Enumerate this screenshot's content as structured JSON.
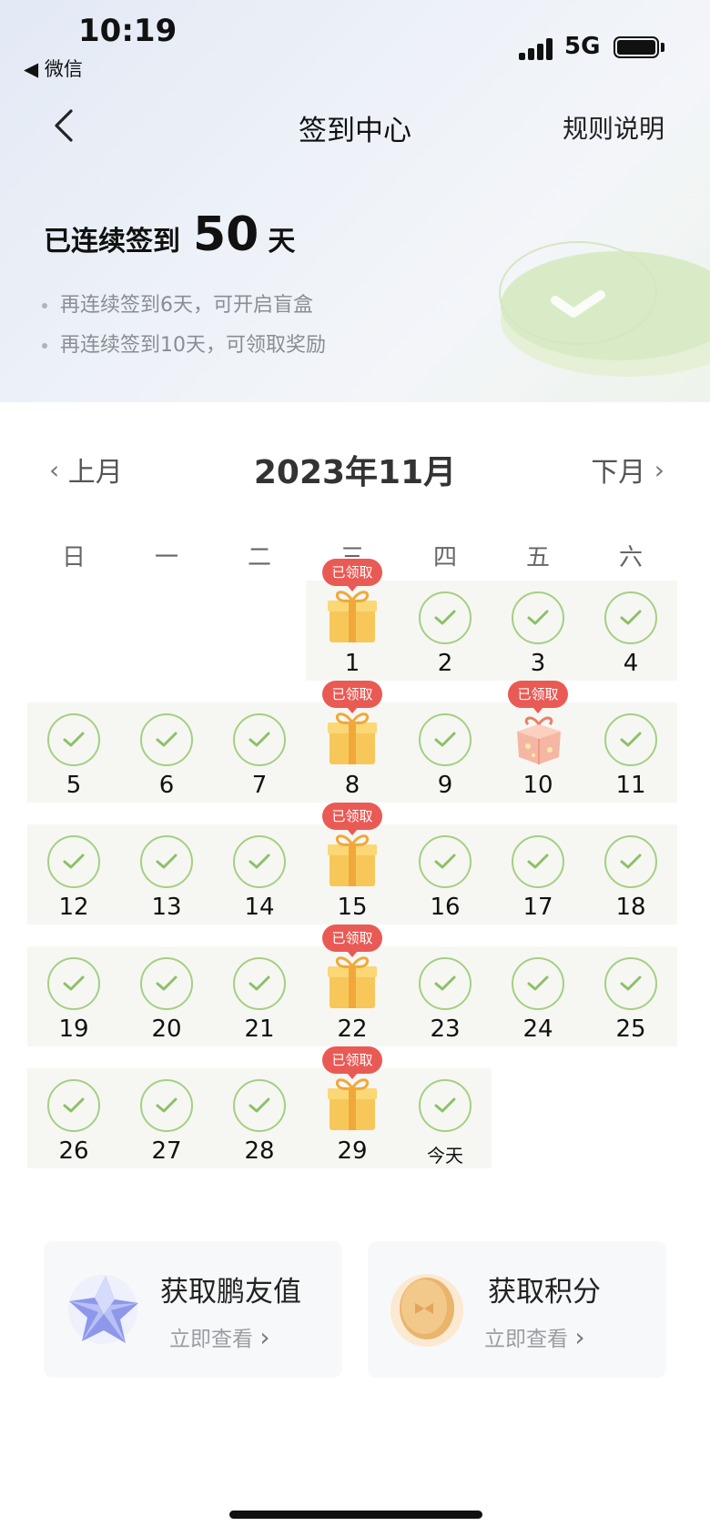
{
  "status_bar": {
    "time": "10:19",
    "back_app": "◀ 微信",
    "network": "5G"
  },
  "nav": {
    "title": "签到中心",
    "rules": "规则说明"
  },
  "streak": {
    "prefix": "已连续签到",
    "days": "50",
    "suffix": "天"
  },
  "tips": [
    "再连续签到6天，可开启盲盒",
    "再连续签到10天，可领取奖励"
  ],
  "calendar": {
    "prev_label": "上月",
    "next_label": "下月",
    "month_title": "2023年11月",
    "weekdays": [
      "日",
      "一",
      "二",
      "三",
      "四",
      "五",
      "六"
    ],
    "badge_label": "已领取",
    "days": [
      {
        "label": "1",
        "type": "gift",
        "claimed": true
      },
      {
        "label": "2",
        "type": "checked"
      },
      {
        "label": "3",
        "type": "checked"
      },
      {
        "label": "4",
        "type": "checked"
      },
      {
        "label": "5",
        "type": "checked"
      },
      {
        "label": "6",
        "type": "checked"
      },
      {
        "label": "7",
        "type": "checked"
      },
      {
        "label": "8",
        "type": "gift",
        "claimed": true
      },
      {
        "label": "9",
        "type": "checked"
      },
      {
        "label": "10",
        "type": "blindbox",
        "claimed": true
      },
      {
        "label": "11",
        "type": "checked"
      },
      {
        "label": "12",
        "type": "checked"
      },
      {
        "label": "13",
        "type": "checked"
      },
      {
        "label": "14",
        "type": "checked"
      },
      {
        "label": "15",
        "type": "gift",
        "claimed": true
      },
      {
        "label": "16",
        "type": "checked"
      },
      {
        "label": "17",
        "type": "checked"
      },
      {
        "label": "18",
        "type": "checked"
      },
      {
        "label": "19",
        "type": "checked"
      },
      {
        "label": "20",
        "type": "checked"
      },
      {
        "label": "21",
        "type": "checked"
      },
      {
        "label": "22",
        "type": "gift",
        "claimed": true
      },
      {
        "label": "23",
        "type": "checked"
      },
      {
        "label": "24",
        "type": "checked"
      },
      {
        "label": "25",
        "type": "checked"
      },
      {
        "label": "26",
        "type": "checked"
      },
      {
        "label": "27",
        "type": "checked"
      },
      {
        "label": "28",
        "type": "checked"
      },
      {
        "label": "29",
        "type": "gift",
        "claimed": true
      },
      {
        "label": "今天",
        "type": "checked",
        "today": true
      }
    ]
  },
  "cards": [
    {
      "title": "获取鹏友值",
      "link": "立即查看",
      "icon": "crystal-star-icon"
    },
    {
      "title": "获取积分",
      "link": "立即查看",
      "icon": "gold-coin-icon"
    }
  ],
  "colors": {
    "check_green": "#a5cf84",
    "badge_red": "#ea5a55",
    "row_bg": "#f6f7f2"
  }
}
